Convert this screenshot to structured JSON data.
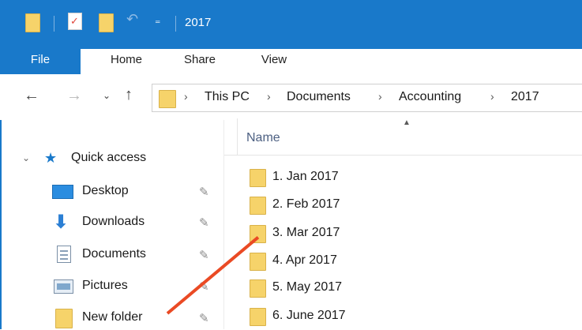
{
  "title_bar": {
    "title": "2017"
  },
  "ribbon_tabs": [
    "File",
    "Home",
    "Share",
    "View"
  ],
  "address_bar": {
    "crumbs": [
      "This PC",
      "Documents",
      "Accounting",
      "2017"
    ]
  },
  "quick_access": {
    "label": "Quick access",
    "items": [
      {
        "label": "Desktop",
        "icon": "desktop-icon",
        "pinned": true
      },
      {
        "label": "Downloads",
        "icon": "download-arrow-icon",
        "pinned": true
      },
      {
        "label": "Documents",
        "icon": "documents-icon",
        "pinned": true
      },
      {
        "label": "Pictures",
        "icon": "pictures-icon",
        "pinned": true
      },
      {
        "label": "New folder",
        "icon": "folder-icon",
        "pinned": true
      }
    ]
  },
  "file_list": {
    "column_name": "Name",
    "items": [
      "1. Jan 2017",
      "2. Feb 2017",
      "3. Mar 2017",
      "4. Apr 2017",
      "5. May 2017",
      "6. June 2017"
    ]
  },
  "colors": {
    "accent": "#1979ca",
    "folder": "#f6d36a",
    "annotation_arrow": "#ea4a24"
  }
}
